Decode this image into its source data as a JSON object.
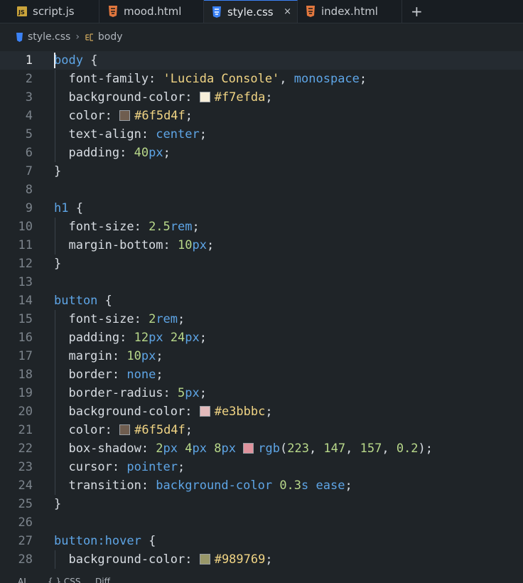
{
  "tabs": [
    {
      "label": "script.js",
      "icon": "js-icon",
      "active": false
    },
    {
      "label": "mood.html",
      "icon": "html5-icon",
      "active": false
    },
    {
      "label": "style.css",
      "icon": "css3-icon",
      "active": true,
      "close": "×"
    },
    {
      "label": "index.html",
      "icon": "html5-icon",
      "active": false
    }
  ],
  "new_tab_label": "+",
  "breadcrumb": {
    "file": "style.css",
    "separator": "›",
    "symbol": "body"
  },
  "current_line": 1,
  "colors": {
    "accent": "#3b82f6",
    "background": "#1f2428"
  },
  "code_lines": [
    [
      {
        "t": "body",
        "c": "k"
      },
      {
        "t": " {",
        "c": "p"
      }
    ],
    [
      {
        "t": "  font-family: ",
        "c": "p"
      },
      {
        "t": "'Lucida Console'",
        "c": "s"
      },
      {
        "t": ", ",
        "c": "p"
      },
      {
        "t": "monospace",
        "c": "v"
      },
      {
        "t": ";",
        "c": "p"
      }
    ],
    [
      {
        "t": "  background-color: ",
        "c": "p"
      },
      {
        "sw": "#f7efda"
      },
      {
        "t": "#f7efda",
        "c": "h"
      },
      {
        "t": ";",
        "c": "p"
      }
    ],
    [
      {
        "t": "  color: ",
        "c": "p"
      },
      {
        "sw": "#6f5d4f"
      },
      {
        "t": "#6f5d4f",
        "c": "h"
      },
      {
        "t": ";",
        "c": "p"
      }
    ],
    [
      {
        "t": "  text-align: ",
        "c": "p"
      },
      {
        "t": "center",
        "c": "v"
      },
      {
        "t": ";",
        "c": "p"
      }
    ],
    [
      {
        "t": "  padding: ",
        "c": "p"
      },
      {
        "t": "40",
        "c": "n"
      },
      {
        "t": "px",
        "c": "u"
      },
      {
        "t": ";",
        "c": "p"
      }
    ],
    [
      {
        "t": "}",
        "c": "p"
      }
    ],
    [],
    [
      {
        "t": "h1",
        "c": "k"
      },
      {
        "t": " {",
        "c": "p"
      }
    ],
    [
      {
        "t": "  font-size: ",
        "c": "p"
      },
      {
        "t": "2.5",
        "c": "n"
      },
      {
        "t": "rem",
        "c": "u"
      },
      {
        "t": ";",
        "c": "p"
      }
    ],
    [
      {
        "t": "  margin-bottom: ",
        "c": "p"
      },
      {
        "t": "10",
        "c": "n"
      },
      {
        "t": "px",
        "c": "u"
      },
      {
        "t": ";",
        "c": "p"
      }
    ],
    [
      {
        "t": "}",
        "c": "p"
      }
    ],
    [],
    [
      {
        "t": "button",
        "c": "k"
      },
      {
        "t": " {",
        "c": "p"
      }
    ],
    [
      {
        "t": "  font-size: ",
        "c": "p"
      },
      {
        "t": "2",
        "c": "n"
      },
      {
        "t": "rem",
        "c": "u"
      },
      {
        "t": ";",
        "c": "p"
      }
    ],
    [
      {
        "t": "  padding: ",
        "c": "p"
      },
      {
        "t": "12",
        "c": "n"
      },
      {
        "t": "px",
        "c": "u"
      },
      {
        "t": " ",
        "c": "p"
      },
      {
        "t": "24",
        "c": "n"
      },
      {
        "t": "px",
        "c": "u"
      },
      {
        "t": ";",
        "c": "p"
      }
    ],
    [
      {
        "t": "  margin: ",
        "c": "p"
      },
      {
        "t": "10",
        "c": "n"
      },
      {
        "t": "px",
        "c": "u"
      },
      {
        "t": ";",
        "c": "p"
      }
    ],
    [
      {
        "t": "  border: ",
        "c": "p"
      },
      {
        "t": "none",
        "c": "v"
      },
      {
        "t": ";",
        "c": "p"
      }
    ],
    [
      {
        "t": "  border-radius: ",
        "c": "p"
      },
      {
        "t": "5",
        "c": "n"
      },
      {
        "t": "px",
        "c": "u"
      },
      {
        "t": ";",
        "c": "p"
      }
    ],
    [
      {
        "t": "  background-color: ",
        "c": "p"
      },
      {
        "sw": "#e3bbbc"
      },
      {
        "t": "#e3bbbc",
        "c": "h"
      },
      {
        "t": ";",
        "c": "p"
      }
    ],
    [
      {
        "t": "  color: ",
        "c": "p"
      },
      {
        "sw": "#6f5d4f"
      },
      {
        "t": "#6f5d4f",
        "c": "h"
      },
      {
        "t": ";",
        "c": "p"
      }
    ],
    [
      {
        "t": "  box-shadow: ",
        "c": "p"
      },
      {
        "t": "2",
        "c": "n"
      },
      {
        "t": "px",
        "c": "u"
      },
      {
        "t": " ",
        "c": "p"
      },
      {
        "t": "4",
        "c": "n"
      },
      {
        "t": "px",
        "c": "u"
      },
      {
        "t": " ",
        "c": "p"
      },
      {
        "t": "8",
        "c": "n"
      },
      {
        "t": "px",
        "c": "u"
      },
      {
        "t": " ",
        "c": "p"
      },
      {
        "sw": "#df939d"
      },
      {
        "t": "rgb",
        "c": "v"
      },
      {
        "t": "(",
        "c": "p"
      },
      {
        "t": "223",
        "c": "n"
      },
      {
        "t": ", ",
        "c": "p"
      },
      {
        "t": "147",
        "c": "n"
      },
      {
        "t": ", ",
        "c": "p"
      },
      {
        "t": "157",
        "c": "n"
      },
      {
        "t": ", ",
        "c": "p"
      },
      {
        "t": "0.2",
        "c": "n"
      },
      {
        "t": ");",
        "c": "p"
      }
    ],
    [
      {
        "t": "  cursor: ",
        "c": "p"
      },
      {
        "t": "pointer",
        "c": "v"
      },
      {
        "t": ";",
        "c": "p"
      }
    ],
    [
      {
        "t": "  transition: ",
        "c": "p"
      },
      {
        "t": "background-color",
        "c": "v"
      },
      {
        "t": " ",
        "c": "p"
      },
      {
        "t": "0.3",
        "c": "n"
      },
      {
        "t": "s",
        "c": "u"
      },
      {
        "t": " ",
        "c": "p"
      },
      {
        "t": "ease",
        "c": "v"
      },
      {
        "t": ";",
        "c": "p"
      }
    ],
    [
      {
        "t": "}",
        "c": "p"
      }
    ],
    [],
    [
      {
        "t": "button",
        "c": "k"
      },
      {
        "t": ":hover",
        "c": "v"
      },
      {
        "t": " {",
        "c": "p"
      }
    ],
    [
      {
        "t": "  background-color: ",
        "c": "p"
      },
      {
        "sw": "#989769"
      },
      {
        "t": "#989769",
        "c": "h"
      },
      {
        "t": ";",
        "c": "p"
      }
    ]
  ],
  "status": {
    "ai": "AI",
    "language": "{ } CSS",
    "diff": "Diff"
  }
}
